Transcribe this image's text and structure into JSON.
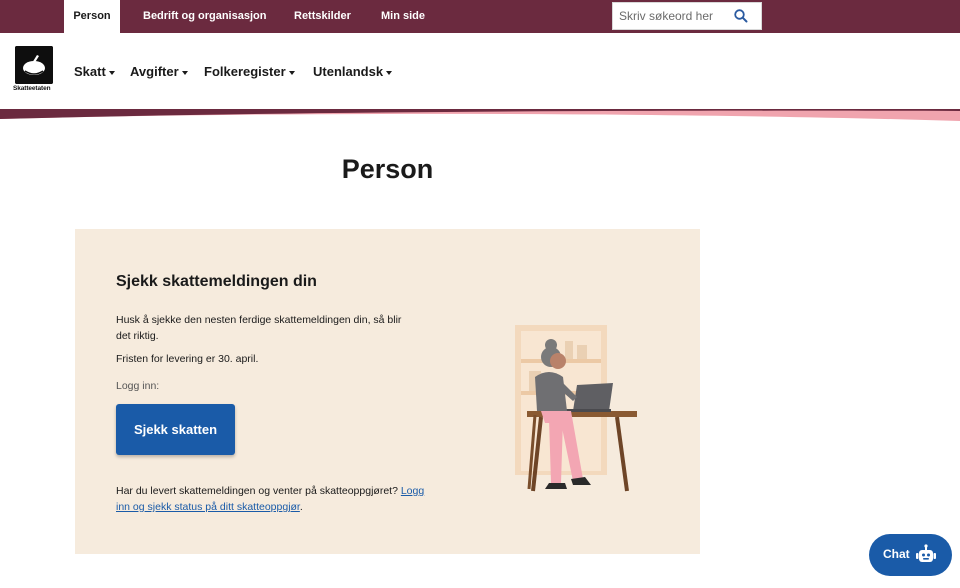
{
  "topnav": {
    "tabs": [
      {
        "label": "Person",
        "active": true
      },
      {
        "label": "Bedrift og organisasjon",
        "active": false
      },
      {
        "label": "Rettskilder",
        "active": false
      },
      {
        "label": "Min side",
        "active": false
      }
    ],
    "search": {
      "placeholder": "Skriv søkeord her",
      "icon": "search-icon"
    }
  },
  "header": {
    "logo_text": "Skatteetaten",
    "menu": [
      "Skatt",
      "Avgifter",
      "Folkeregister",
      "Utenlandsk"
    ]
  },
  "main": {
    "title": "Person",
    "card": {
      "heading": "Sjekk skattemeldingen din",
      "text1": "Husk å sjekke den nesten ferdige skattemeldingen din, så blir det riktig.",
      "text2": "Fristen for levering er 30. april.",
      "login_label": "Logg inn:",
      "button_label": "Sjekk skatten",
      "text3": "Har du levert skattemeldingen og venter på skatteoppgjøret?",
      "link_label": "Logg inn og sjekk status på ditt skatteoppgjør",
      "text3_end": "."
    }
  },
  "chat": {
    "label": "Chat",
    "icon": "robot-icon"
  },
  "colors": {
    "brand": "#6b2a3f",
    "accent_pink": "#f0a4ae",
    "card_bg": "#f6ebdd",
    "button": "#1a5ba8"
  }
}
